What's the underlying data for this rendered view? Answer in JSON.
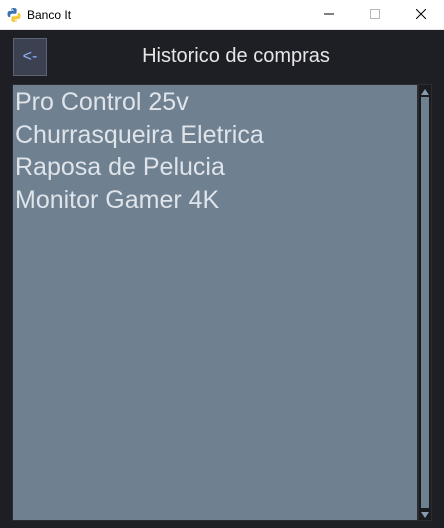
{
  "window": {
    "title": "Banco It"
  },
  "header": {
    "back_label": "<-",
    "title": "Historico de compras"
  },
  "purchases": [
    "Pro Control 25v",
    "Churrasqueira Eletrica",
    "Raposa de Pelucia",
    "Monitor Gamer 4K"
  ],
  "colors": {
    "background": "#1e1f24",
    "list_background": "#6f8090",
    "list_text": "#dfe4ea",
    "back_button_text": "#8fb4ff"
  },
  "icons": {
    "app": "python-logo-icon",
    "minimize": "minimize-icon",
    "maximize": "maximize-icon",
    "close": "close-icon",
    "scroll_up": "scroll-up-arrow-icon",
    "scroll_down": "scroll-down-arrow-icon"
  }
}
